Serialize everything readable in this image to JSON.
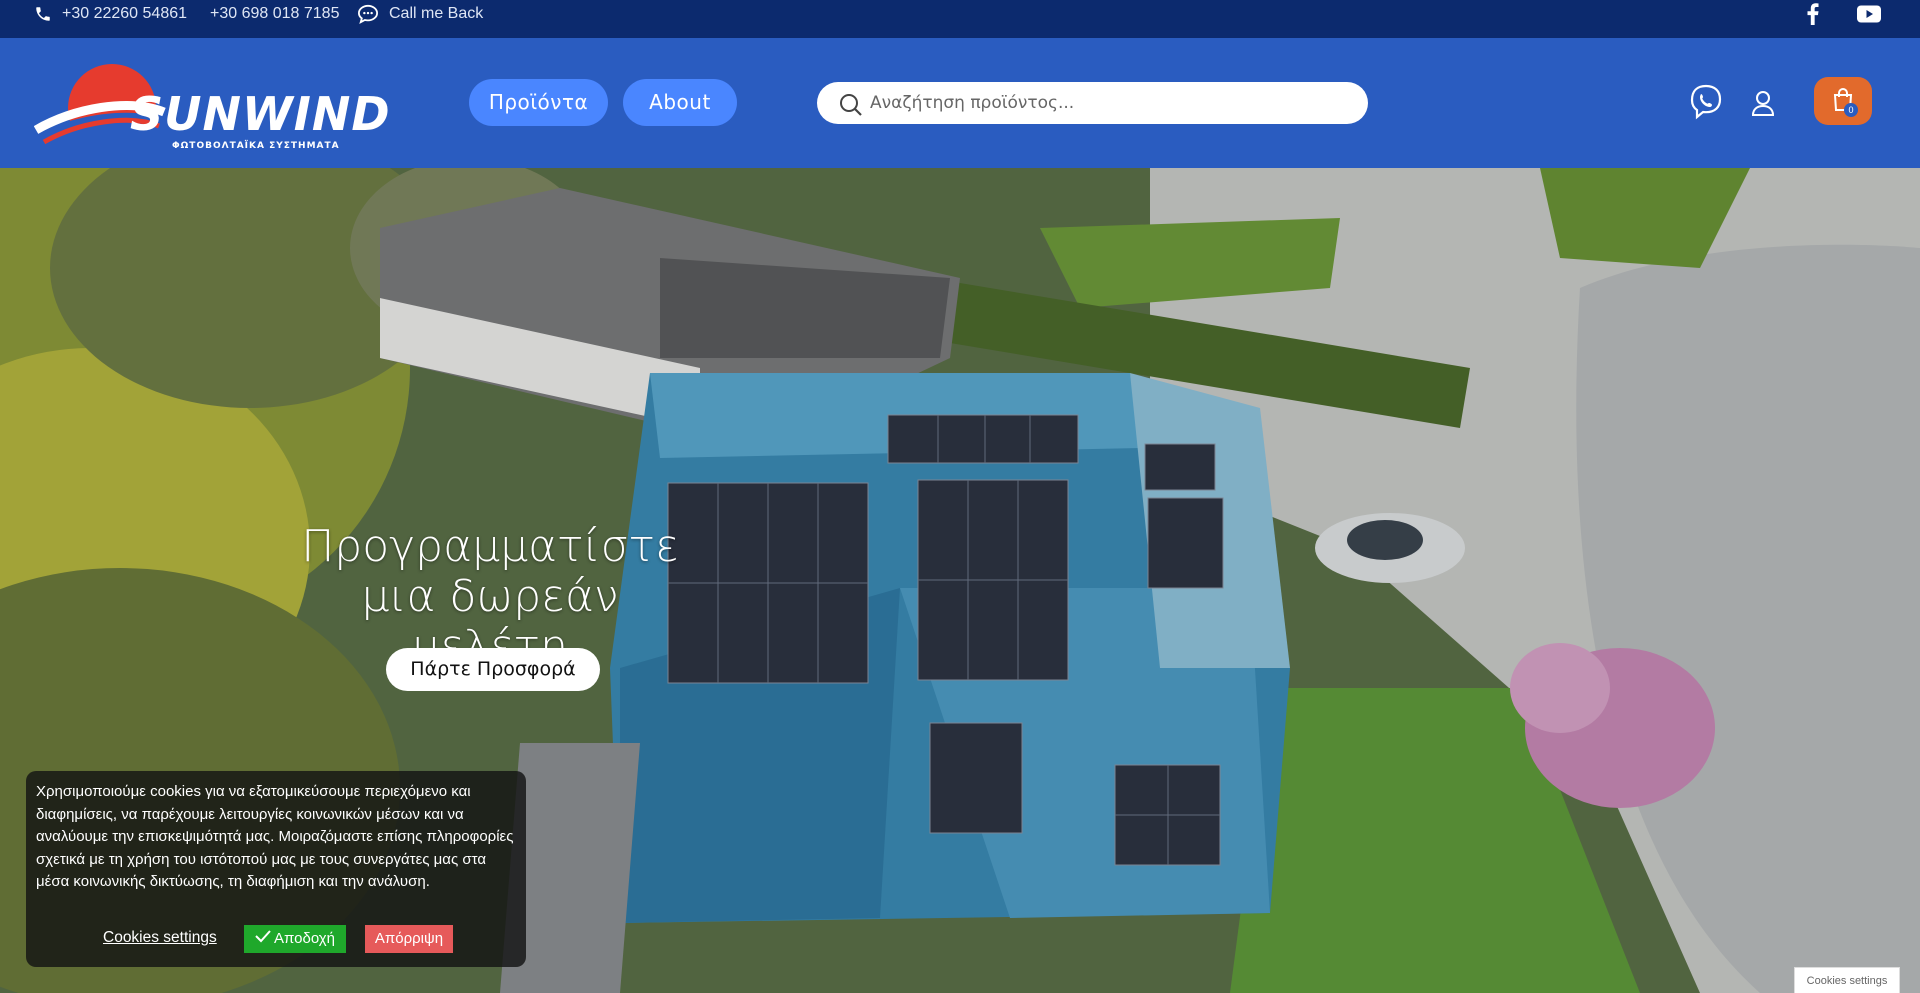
{
  "topbar": {
    "phone1": "+30 22260 54861",
    "phone2": "+30 698 018 7185",
    "callback": "Call me Back",
    "icons": [
      "phone-icon",
      "chat-icon",
      "facebook-icon",
      "youtube-icon"
    ]
  },
  "header": {
    "logo_word": "SUNWIND",
    "logo_sub": "ΦΩΤΟΒΟΛΤΑΪΚΑ ΣΥΣΤΗΜΑΤΑ",
    "nav": [
      "Προϊόντα",
      "About"
    ],
    "search_placeholder": "Αναζήτηση προϊόντος...",
    "cart_count": "0",
    "colors": {
      "header_bg": "#2a5cc0",
      "topbar_bg": "#0c2a6e",
      "nav_btn": "#4a86ff",
      "cart_bg": "#e26a2c"
    }
  },
  "hero": {
    "title_line1": "Προγραμματίστε",
    "title_line2": "μια δωρεάν μελέτη",
    "cta": "Πάρτε Προσφορά"
  },
  "cookie": {
    "text": "Χρησιμοποιούμε cookies για να εξατομικεύσουμε περιεχόμενο και διαφημίσεις, να παρέχουμε λειτουργίες κοινωνικών μέσων και να αναλύουμε την επισκεψιμότητά μας. Μοιραζόμαστε επίσης πληροφορίες σχετικά με τη χρήση του ιστότοπού μας με τους συνεργάτες μας στα μέσα κοινωνικής δικτύωσης, τη διαφήμιση και την ανάλυση.",
    "settings_link": "Cookies settings",
    "accept": "Αποδοχή",
    "reject": "Απόρριψη",
    "tab": "Cookies settings"
  }
}
